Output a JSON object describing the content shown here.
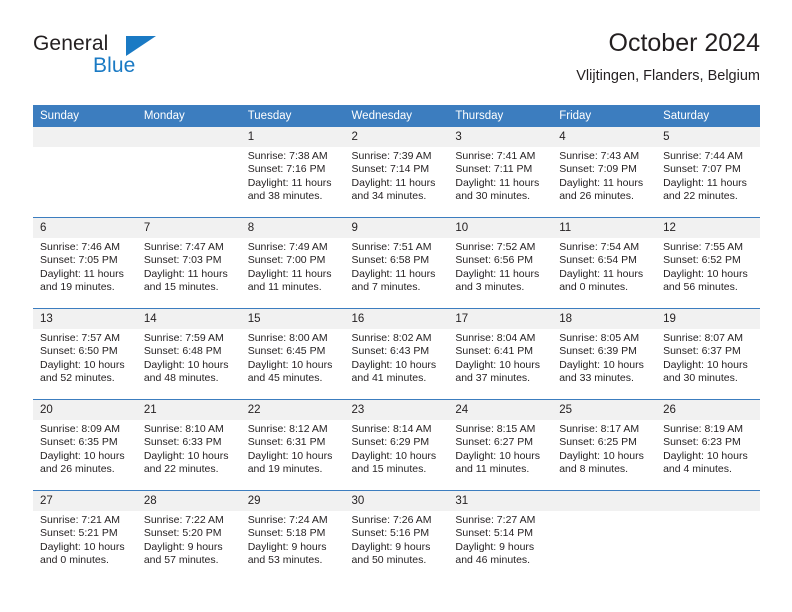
{
  "brand": {
    "name_dark": "General",
    "name_blue": "Blue",
    "triangle_color": "#1a7ac4"
  },
  "header": {
    "title": "October 2024",
    "subtitle": "Vlijtingen, Flanders, Belgium"
  },
  "theme": {
    "header_blue": "#3c7dbf",
    "daynum_band": "#f1f1f1",
    "text": "#231f20"
  },
  "weekday_headers": [
    "Sunday",
    "Monday",
    "Tuesday",
    "Wednesday",
    "Thursday",
    "Friday",
    "Saturday"
  ],
  "labels": {
    "sunrise_prefix": "Sunrise:",
    "sunset_prefix": "Sunset:",
    "daylight_prefix": "Daylight:"
  },
  "weeks": [
    [
      {
        "day": "",
        "sunrise": "",
        "sunset": "",
        "daylight_line1": "",
        "daylight_line2": ""
      },
      {
        "day": "",
        "sunrise": "",
        "sunset": "",
        "daylight_line1": "",
        "daylight_line2": ""
      },
      {
        "day": "1",
        "sunrise": "Sunrise: 7:38 AM",
        "sunset": "Sunset: 7:16 PM",
        "daylight_line1": "Daylight: 11 hours",
        "daylight_line2": "and 38 minutes."
      },
      {
        "day": "2",
        "sunrise": "Sunrise: 7:39 AM",
        "sunset": "Sunset: 7:14 PM",
        "daylight_line1": "Daylight: 11 hours",
        "daylight_line2": "and 34 minutes."
      },
      {
        "day": "3",
        "sunrise": "Sunrise: 7:41 AM",
        "sunset": "Sunset: 7:11 PM",
        "daylight_line1": "Daylight: 11 hours",
        "daylight_line2": "and 30 minutes."
      },
      {
        "day": "4",
        "sunrise": "Sunrise: 7:43 AM",
        "sunset": "Sunset: 7:09 PM",
        "daylight_line1": "Daylight: 11 hours",
        "daylight_line2": "and 26 minutes."
      },
      {
        "day": "5",
        "sunrise": "Sunrise: 7:44 AM",
        "sunset": "Sunset: 7:07 PM",
        "daylight_line1": "Daylight: 11 hours",
        "daylight_line2": "and 22 minutes."
      }
    ],
    [
      {
        "day": "6",
        "sunrise": "Sunrise: 7:46 AM",
        "sunset": "Sunset: 7:05 PM",
        "daylight_line1": "Daylight: 11 hours",
        "daylight_line2": "and 19 minutes."
      },
      {
        "day": "7",
        "sunrise": "Sunrise: 7:47 AM",
        "sunset": "Sunset: 7:03 PM",
        "daylight_line1": "Daylight: 11 hours",
        "daylight_line2": "and 15 minutes."
      },
      {
        "day": "8",
        "sunrise": "Sunrise: 7:49 AM",
        "sunset": "Sunset: 7:00 PM",
        "daylight_line1": "Daylight: 11 hours",
        "daylight_line2": "and 11 minutes."
      },
      {
        "day": "9",
        "sunrise": "Sunrise: 7:51 AM",
        "sunset": "Sunset: 6:58 PM",
        "daylight_line1": "Daylight: 11 hours",
        "daylight_line2": "and 7 minutes."
      },
      {
        "day": "10",
        "sunrise": "Sunrise: 7:52 AM",
        "sunset": "Sunset: 6:56 PM",
        "daylight_line1": "Daylight: 11 hours",
        "daylight_line2": "and 3 minutes."
      },
      {
        "day": "11",
        "sunrise": "Sunrise: 7:54 AM",
        "sunset": "Sunset: 6:54 PM",
        "daylight_line1": "Daylight: 11 hours",
        "daylight_line2": "and 0 minutes."
      },
      {
        "day": "12",
        "sunrise": "Sunrise: 7:55 AM",
        "sunset": "Sunset: 6:52 PM",
        "daylight_line1": "Daylight: 10 hours",
        "daylight_line2": "and 56 minutes."
      }
    ],
    [
      {
        "day": "13",
        "sunrise": "Sunrise: 7:57 AM",
        "sunset": "Sunset: 6:50 PM",
        "daylight_line1": "Daylight: 10 hours",
        "daylight_line2": "and 52 minutes."
      },
      {
        "day": "14",
        "sunrise": "Sunrise: 7:59 AM",
        "sunset": "Sunset: 6:48 PM",
        "daylight_line1": "Daylight: 10 hours",
        "daylight_line2": "and 48 minutes."
      },
      {
        "day": "15",
        "sunrise": "Sunrise: 8:00 AM",
        "sunset": "Sunset: 6:45 PM",
        "daylight_line1": "Daylight: 10 hours",
        "daylight_line2": "and 45 minutes."
      },
      {
        "day": "16",
        "sunrise": "Sunrise: 8:02 AM",
        "sunset": "Sunset: 6:43 PM",
        "daylight_line1": "Daylight: 10 hours",
        "daylight_line2": "and 41 minutes."
      },
      {
        "day": "17",
        "sunrise": "Sunrise: 8:04 AM",
        "sunset": "Sunset: 6:41 PM",
        "daylight_line1": "Daylight: 10 hours",
        "daylight_line2": "and 37 minutes."
      },
      {
        "day": "18",
        "sunrise": "Sunrise: 8:05 AM",
        "sunset": "Sunset: 6:39 PM",
        "daylight_line1": "Daylight: 10 hours",
        "daylight_line2": "and 33 minutes."
      },
      {
        "day": "19",
        "sunrise": "Sunrise: 8:07 AM",
        "sunset": "Sunset: 6:37 PM",
        "daylight_line1": "Daylight: 10 hours",
        "daylight_line2": "and 30 minutes."
      }
    ],
    [
      {
        "day": "20",
        "sunrise": "Sunrise: 8:09 AM",
        "sunset": "Sunset: 6:35 PM",
        "daylight_line1": "Daylight: 10 hours",
        "daylight_line2": "and 26 minutes."
      },
      {
        "day": "21",
        "sunrise": "Sunrise: 8:10 AM",
        "sunset": "Sunset: 6:33 PM",
        "daylight_line1": "Daylight: 10 hours",
        "daylight_line2": "and 22 minutes."
      },
      {
        "day": "22",
        "sunrise": "Sunrise: 8:12 AM",
        "sunset": "Sunset: 6:31 PM",
        "daylight_line1": "Daylight: 10 hours",
        "daylight_line2": "and 19 minutes."
      },
      {
        "day": "23",
        "sunrise": "Sunrise: 8:14 AM",
        "sunset": "Sunset: 6:29 PM",
        "daylight_line1": "Daylight: 10 hours",
        "daylight_line2": "and 15 minutes."
      },
      {
        "day": "24",
        "sunrise": "Sunrise: 8:15 AM",
        "sunset": "Sunset: 6:27 PM",
        "daylight_line1": "Daylight: 10 hours",
        "daylight_line2": "and 11 minutes."
      },
      {
        "day": "25",
        "sunrise": "Sunrise: 8:17 AM",
        "sunset": "Sunset: 6:25 PM",
        "daylight_line1": "Daylight: 10 hours",
        "daylight_line2": "and 8 minutes."
      },
      {
        "day": "26",
        "sunrise": "Sunrise: 8:19 AM",
        "sunset": "Sunset: 6:23 PM",
        "daylight_line1": "Daylight: 10 hours",
        "daylight_line2": "and 4 minutes."
      }
    ],
    [
      {
        "day": "27",
        "sunrise": "Sunrise: 7:21 AM",
        "sunset": "Sunset: 5:21 PM",
        "daylight_line1": "Daylight: 10 hours",
        "daylight_line2": "and 0 minutes."
      },
      {
        "day": "28",
        "sunrise": "Sunrise: 7:22 AM",
        "sunset": "Sunset: 5:20 PM",
        "daylight_line1": "Daylight: 9 hours",
        "daylight_line2": "and 57 minutes."
      },
      {
        "day": "29",
        "sunrise": "Sunrise: 7:24 AM",
        "sunset": "Sunset: 5:18 PM",
        "daylight_line1": "Daylight: 9 hours",
        "daylight_line2": "and 53 minutes."
      },
      {
        "day": "30",
        "sunrise": "Sunrise: 7:26 AM",
        "sunset": "Sunset: 5:16 PM",
        "daylight_line1": "Daylight: 9 hours",
        "daylight_line2": "and 50 minutes."
      },
      {
        "day": "31",
        "sunrise": "Sunrise: 7:27 AM",
        "sunset": "Sunset: 5:14 PM",
        "daylight_line1": "Daylight: 9 hours",
        "daylight_line2": "and 46 minutes."
      },
      {
        "day": "",
        "sunrise": "",
        "sunset": "",
        "daylight_line1": "",
        "daylight_line2": ""
      },
      {
        "day": "",
        "sunrise": "",
        "sunset": "",
        "daylight_line1": "",
        "daylight_line2": ""
      }
    ]
  ]
}
